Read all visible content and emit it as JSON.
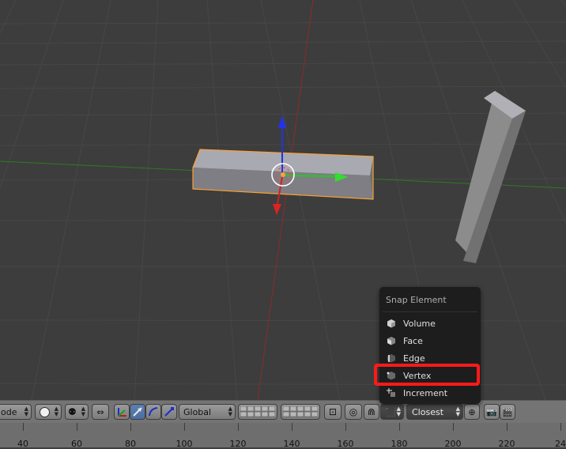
{
  "header": {
    "mode_label": "ode",
    "orientation_label": "Global",
    "snap_target_label": "Closest"
  },
  "snap_menu": {
    "title": "Snap Element",
    "items": [
      {
        "label": "Volume",
        "icon": "volume-icon"
      },
      {
        "label": "Face",
        "icon": "face-icon"
      },
      {
        "label": "Edge",
        "icon": "edge-icon"
      },
      {
        "label": "Vertex",
        "icon": "vertex-icon",
        "selected": true
      },
      {
        "label": "Increment",
        "icon": "increment-icon"
      }
    ]
  },
  "ruler": {
    "labels": [
      "40",
      "60",
      "80",
      "100",
      "120",
      "140",
      "160",
      "180",
      "200",
      "220",
      "24"
    ]
  },
  "colors": {
    "viewport_bg": "#3d3d3d",
    "grid": "#4a4a4a",
    "x_axis": "#8c2b2b",
    "y_axis": "#3f7a2a",
    "selection_outline": "#ffa033",
    "highlight": "#ff1a1a"
  }
}
